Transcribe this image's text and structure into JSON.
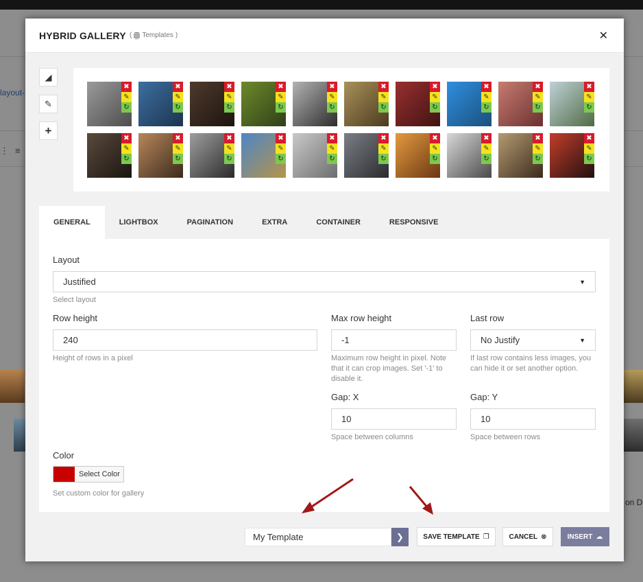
{
  "background": {
    "link_fragment": "layout-",
    "right_text": "on D"
  },
  "modal": {
    "title": "HYBRID GALLERY",
    "subtitle": "Templates",
    "close_symbol": "✕"
  },
  "tools": [
    {
      "name": "eraser-icon",
      "glyph": "◢"
    },
    {
      "name": "pencil-icon",
      "glyph": "✎"
    },
    {
      "name": "plus-icon",
      "glyph": "+"
    }
  ],
  "thumbnails": [
    {
      "name": "thumb-chalkboard-girl",
      "colors": [
        "#9a9a9a",
        "#4d4d4d"
      ]
    },
    {
      "name": "thumb-shark-rocket",
      "colors": [
        "#3d6f9f",
        "#1c3450"
      ]
    },
    {
      "name": "thumb-cocktail-figures",
      "colors": [
        "#4e3a2b",
        "#1c1410"
      ]
    },
    {
      "name": "thumb-sandwich-man",
      "colors": [
        "#6d8a2a",
        "#2f3f18"
      ]
    },
    {
      "name": "thumb-horse",
      "colors": [
        "#b3b3b3",
        "#2d2d2d"
      ]
    },
    {
      "name": "thumb-ancient-dancers",
      "colors": [
        "#a9915a",
        "#4b3a1f"
      ]
    },
    {
      "name": "thumb-meat-heart",
      "colors": [
        "#9a2f2f",
        "#3f1313"
      ]
    },
    {
      "name": "thumb-globe",
      "colors": [
        "#2f8fe0",
        "#1b4f7a"
      ]
    },
    {
      "name": "thumb-eating-woman",
      "colors": [
        "#c77c70",
        "#6b3030"
      ]
    },
    {
      "name": "thumb-landscape",
      "colors": [
        "#bfd1d6",
        "#4f6b45"
      ]
    },
    {
      "name": "thumb-dark-food",
      "colors": [
        "#5a4a3c",
        "#1a1511"
      ]
    },
    {
      "name": "thumb-sharpei-dog",
      "colors": [
        "#b8875c",
        "#3a2a1b"
      ]
    },
    {
      "name": "thumb-eiffel-tower",
      "colors": [
        "#9e9e9e",
        "#2a2a2a"
      ]
    },
    {
      "name": "thumb-sky-road",
      "colors": [
        "#4c86c7",
        "#b79447"
      ]
    },
    {
      "name": "thumb-cat-leaping",
      "colors": [
        "#c9c9c9",
        "#6e6e6e"
      ]
    },
    {
      "name": "thumb-city-street",
      "colors": [
        "#7a7f86",
        "#2b2b2e"
      ]
    },
    {
      "name": "thumb-bowling-pins",
      "colors": [
        "#e39a3f",
        "#6a3713"
      ]
    },
    {
      "name": "thumb-juggler",
      "colors": [
        "#d8d8d8",
        "#4a4a4a"
      ]
    },
    {
      "name": "thumb-sand-tree",
      "colors": [
        "#b59a73",
        "#3b2b1c"
      ]
    },
    {
      "name": "thumb-flag-ball",
      "colors": [
        "#c33d2a",
        "#1f1010"
      ]
    }
  ],
  "thumb_actions": {
    "delete": "✖",
    "edit": "✎",
    "replace": "↻"
  },
  "tabs": [
    "GENERAL",
    "LIGHTBOX",
    "PAGINATION",
    "EXTRA",
    "CONTAINER",
    "RESPONSIVE"
  ],
  "form": {
    "layout_label": "Layout",
    "layout_value": "Justified",
    "layout_hint": "Select layout",
    "row_height_label": "Row height",
    "row_height_value": "240",
    "row_height_hint": "Height of rows in a pixel",
    "max_row_height_label": "Max row height",
    "max_row_height_value": "-1",
    "max_row_height_hint": "Maximum row height in pixel. Note that it can crop images. Set '-1' to disable it.",
    "last_row_label": "Last row",
    "last_row_value": "No Justify",
    "last_row_hint": "If last row contains less images, you can hide it or set another option.",
    "gap_x_label": "Gap: X",
    "gap_x_value": "10",
    "gap_x_hint": "Space between columns",
    "gap_y_label": "Gap: Y",
    "gap_y_value": "10",
    "gap_y_hint": "Space between rows",
    "color_label": "Color",
    "color_button": "Select Color",
    "color_value": "#c80000",
    "color_hint": "Set custom color for gallery",
    "caret": "▼"
  },
  "footer": {
    "template_name_value": "My Template",
    "go_symbol": "❯",
    "save_template": "SAVE TEMPLATE",
    "save_icon": "❐",
    "cancel": "CANCEL",
    "cancel_icon": "⊗",
    "insert": "INSERT",
    "insert_icon": "☁"
  },
  "colors": {
    "accent": "#6c6f94",
    "arrow": "#a01818",
    "delete": "#d81b2b",
    "edit": "#f5e21b",
    "replace": "#7ec850"
  }
}
